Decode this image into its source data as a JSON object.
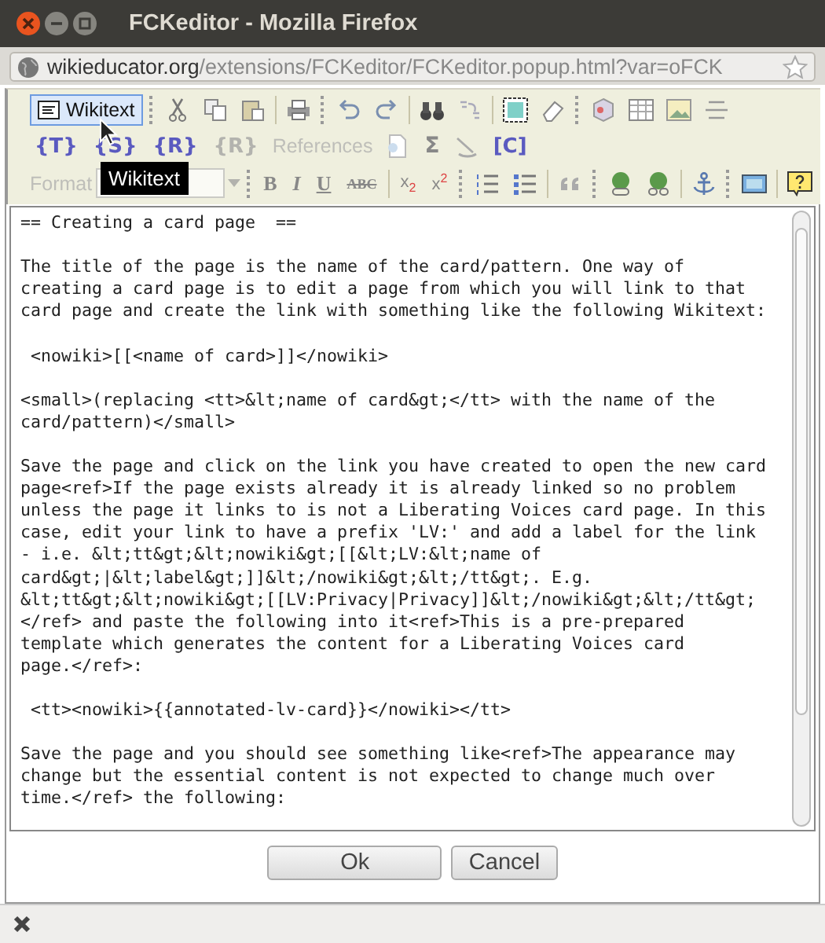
{
  "window": {
    "title": "FCKeditor - Mozilla Firefox"
  },
  "address_bar": {
    "host": "wikieducator.org",
    "path": "/extensions/FCKeditor/FCKeditor.popup.html?var=oFCK"
  },
  "toolbar": {
    "wikitext_button": {
      "label": "Wikitext",
      "selected": true
    },
    "row_2": [
      {
        "text": "{T}",
        "disabled": false
      },
      {
        "text": "{S}",
        "disabled": false
      },
      {
        "text": "{R}",
        "disabled": false
      },
      {
        "text": "{R}",
        "disabled": true
      }
    ],
    "references_button": {
      "label": "References",
      "disabled": true
    },
    "sigma": "Σ",
    "c_button": "[C]",
    "format_select": {
      "placeholder": "Format",
      "disabled": true
    },
    "row_3_glyphs": [
      "B",
      "I",
      "U",
      "ABC"
    ],
    "subscript": {
      "base": "x",
      "mark": "2"
    },
    "superscript": {
      "base": "x",
      "mark": "2"
    },
    "tooltip": "Wikitext"
  },
  "editor": {
    "paragraphs": [
      {
        "lines": [
          "== Creating a card page  =="
        ]
      },
      {
        "lines": [
          "The title of the page is the name of the card/pattern. One way of",
          "creating a card page is to edit a page from which you will link to that",
          "card page and create the link with something like the following Wikitext:"
        ]
      },
      {
        "lines": [
          " <nowiki>[[<name of card>]]</nowiki>"
        ]
      },
      {
        "lines": [
          "<small>(replacing <tt>&lt;name of card&gt;</tt> with the name of the",
          "card/pattern)</small>"
        ]
      },
      {
        "lines": [
          "Save the page and click on the link you have created to open the new card",
          "page<ref>If the page exists already it is already linked so no problem",
          "unless the page it links to is not a Liberating Voices card page. In this",
          "case, edit your link to have a prefix 'LV:' and add a label for the link",
          "- i.e. &lt;tt&gt;&lt;nowiki&gt;[[&lt;LV:&lt;name of",
          "card&gt;|&lt;label&gt;]]&lt;/nowiki&gt;&lt;/tt&gt;. E.g.",
          "&lt;tt&gt;&lt;nowiki&gt;[[LV:Privacy|Privacy]]&lt;/nowiki&gt;&lt;/tt&gt;",
          "</ref> and paste the following into it<ref>This is a pre-prepared",
          "template which generates the content for a Liberating Voices card",
          "page.</ref>:"
        ]
      },
      {
        "lines": [
          " <tt><nowiki>{{annotated-lv-card}}</nowiki></tt>"
        ]
      },
      {
        "lines": [
          "Save the page and you should see something like<ref>The appearance may",
          "change but the essential content is not expected to change much over",
          "time.</ref> the following:"
        ]
      }
    ]
  },
  "buttons": [
    {
      "label": "Ok"
    },
    {
      "label": "Cancel"
    }
  ]
}
